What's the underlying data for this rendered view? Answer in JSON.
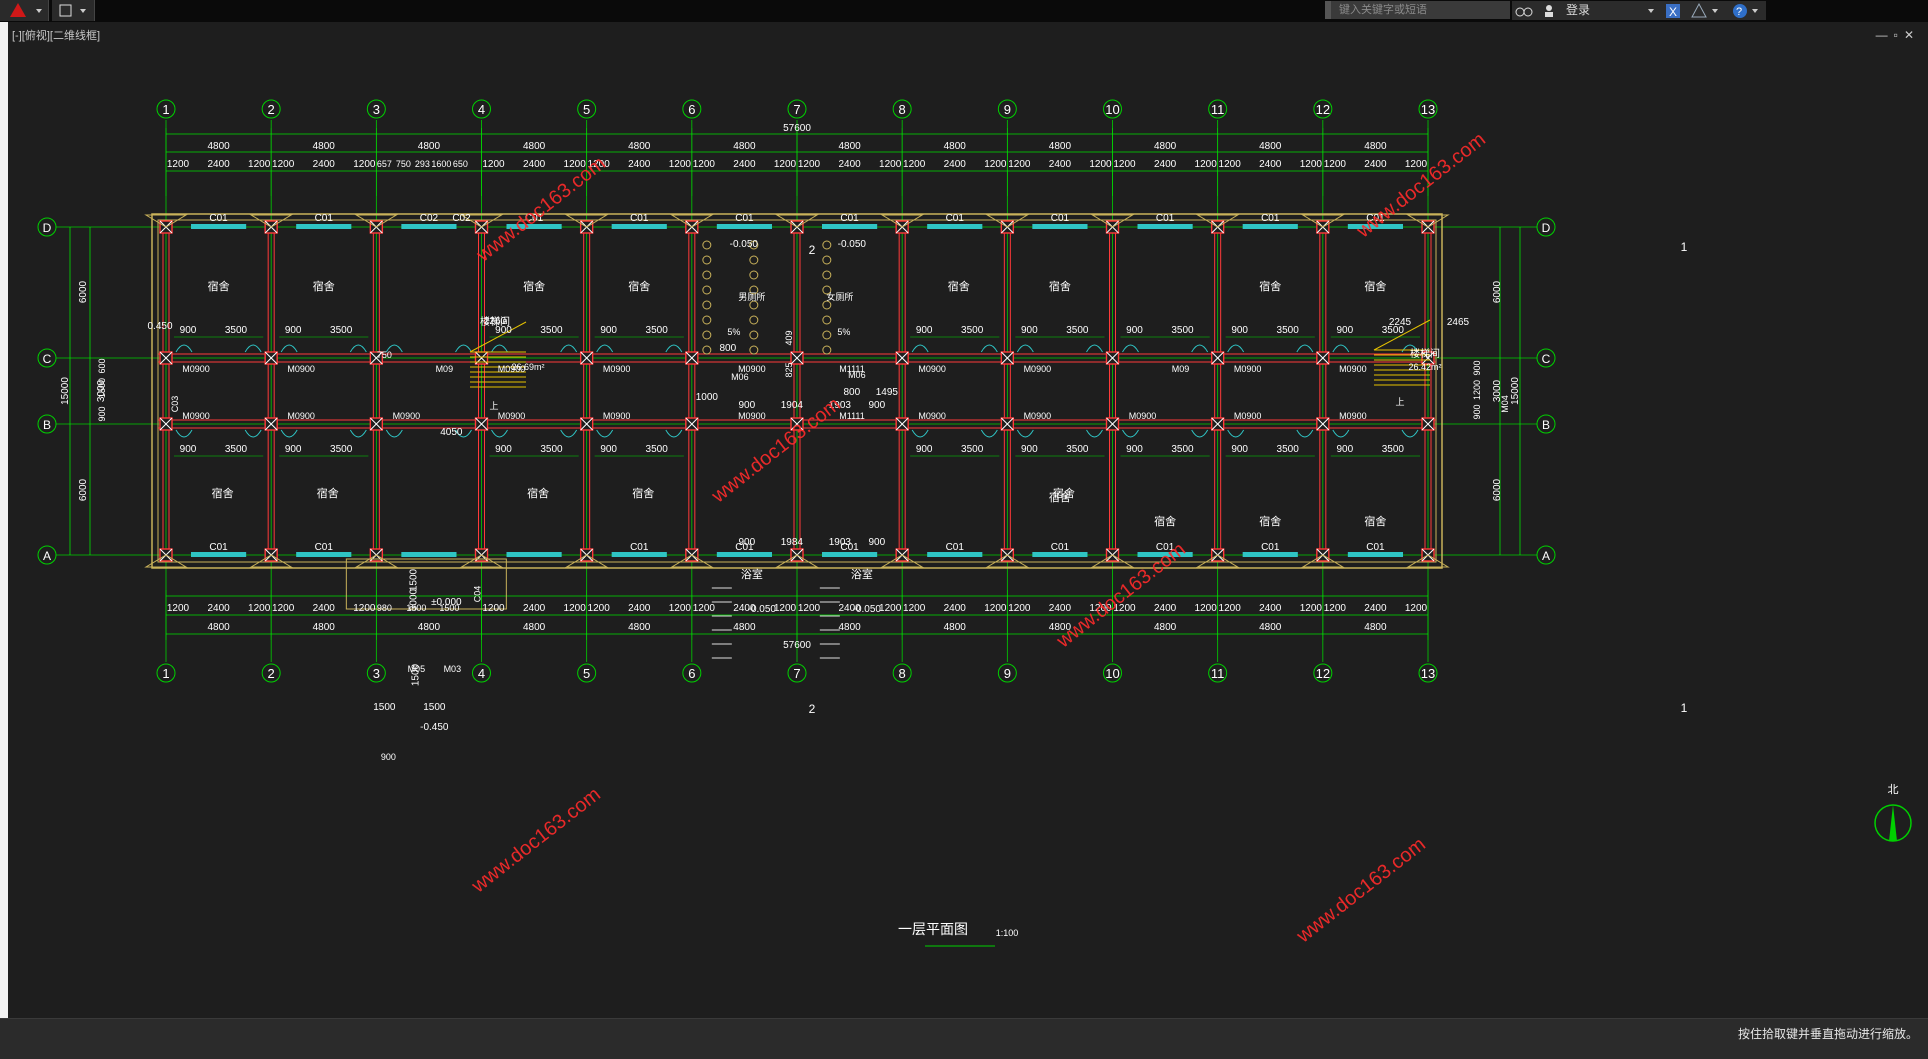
{
  "app": {
    "search_placeholder": "键入关键字或短语",
    "login": "登录",
    "view_label": "[-][俯视][二维线框]",
    "status": "按住拾取键并垂直拖动进行缩放。"
  },
  "drawing": {
    "axes_h": [
      "1",
      "2",
      "3",
      "4",
      "5",
      "6",
      "7",
      "8",
      "9",
      "10",
      "11",
      "12",
      "13"
    ],
    "axes_v": [
      "D",
      "C",
      "B",
      "A"
    ],
    "total": "57600",
    "bay": "4800",
    "top_sub": [
      "1200",
      "2400",
      "1200",
      "1200",
      "2400",
      "1200",
      "657",
      "750",
      "293",
      "1600",
      "650",
      "1200",
      "2400",
      "1200",
      "1200",
      "2400",
      "1200",
      "1200",
      "2400",
      "1200",
      "1200",
      "2400",
      "1200",
      "1200",
      "2400",
      "1200",
      "1200",
      "2400",
      "1200",
      "1200",
      "2400",
      "1200",
      "1200",
      "2400",
      "1200",
      "1200",
      "2400",
      "1200",
      "1200",
      "2400",
      "1200"
    ],
    "bottom_sub": [
      "1200",
      "2400",
      "1200",
      "1200",
      "2400",
      "1200",
      "980",
      "1500",
      "1500",
      "1200",
      "2400",
      "1200",
      "1200",
      "2400",
      "1200",
      "1200",
      "2400",
      "1200",
      "1200",
      "2400",
      "1200",
      "1200",
      "2400",
      "1200",
      "1200",
      "2400",
      "1200",
      "1200",
      "2400",
      "1200",
      "1200",
      "2400",
      "1200",
      "1200",
      "2400",
      "1200"
    ],
    "vert_dims_left": [
      "6000",
      "3000",
      "6000",
      "15000",
      "600",
      "1500",
      "900",
      "900"
    ],
    "vert_dims_right": [
      "6000",
      "3000",
      "6000",
      "15000",
      "900",
      "1200",
      "900"
    ],
    "room": "宿舍",
    "stair": "楼梯间",
    "stair_area_1": "26.69m²",
    "stair_area_2": "26.42m²",
    "bath": "浴室",
    "toilet_m": "男厕所",
    "toilet_f": "女厕所",
    "window": "C01",
    "window2": "C02",
    "door": "M0900",
    "door_m09": "M09",
    "door_m06": "M06",
    "door_m1111": "M1111",
    "door_m05": "M05",
    "door_m03": "M03",
    "door_m04": "M04",
    "c03": "C03",
    "c04": "C04",
    "lvl_0450": "0.450",
    "lvl_m0050": "-0.050",
    "lvl_m0450": "-0.450",
    "lvl_000": "±0.000",
    "slope": "5%",
    "d900": "900",
    "d3500": "3500",
    "d2260": "2260",
    "d2245": "2245",
    "d2465": "2465",
    "d4050": "4050",
    "d750": "750",
    "d1500": "1500",
    "d3000": "3000",
    "d800": "800",
    "d1000": "1000",
    "d1904": "1904",
    "d1903": "1903",
    "d1984": "1984",
    "d1495": "1495",
    "d825": "825",
    "d409": "409",
    "up": "上",
    "sec1": "1",
    "sec2": "2",
    "plan_title": "一层平面图",
    "scale": "1:100",
    "north": "北",
    "watermark": "www.doc163.com"
  },
  "colors": {
    "axis": "#00d000",
    "wall": "#c9b25a",
    "column": "#ff3a3a",
    "window": "#2fc4c4",
    "text": "#ffffff",
    "dim": "#00e000"
  }
}
